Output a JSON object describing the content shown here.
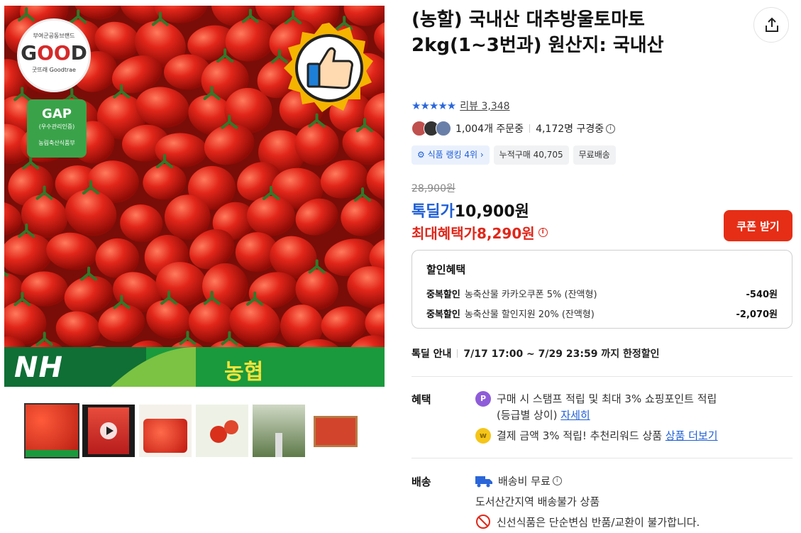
{
  "gallery": {
    "badge_good_top": "부여군공동브랜드",
    "badge_good_word": "GOOD",
    "badge_good_bottom": "굿뜨래 Goodtrae",
    "badge_gap_title": "GAP",
    "badge_gap_sub": "(우수관리인증)",
    "badge_gap_org": "농림축산식품부",
    "bar_logo": "NH",
    "bar_name": "농협",
    "thumbnail_count": 6
  },
  "product": {
    "title": "(농할) 국내산 대추방울토마토 2kg(1~3번과) 원산지: 국내산"
  },
  "rating": {
    "stars": "★★★★★",
    "review_text": "리뷰 3,348"
  },
  "orders": {
    "ordering": "1,004개 주문중",
    "viewing": "4,172명 구경중"
  },
  "chips": {
    "ranking": "식품 랭킹 4위",
    "cumulative": "누적구매 40,705",
    "free_ship": "무료배송"
  },
  "price": {
    "original": "28,900원",
    "deal_label": "톡딜가",
    "deal_price": "10,900원",
    "max_label": "최대혜택가",
    "max_price": "8,290원",
    "coupon_button": "쿠폰 받기"
  },
  "discounts": {
    "title": "할인혜택",
    "rows": [
      {
        "kind": "중복할인",
        "desc": "농축산물 카카오쿠폰 5% (잔액형)",
        "amount": "-540원"
      },
      {
        "kind": "중복할인",
        "desc": "농축산물 할인지원 20% (잔액형)",
        "amount": "-2,070원"
      }
    ]
  },
  "notice": {
    "label": "톡딜 안내",
    "text": "7/17 17:00 ~ 7/29 23:59 까지 한정할인"
  },
  "benefits": {
    "label": "혜택",
    "line1": "구매 시 스탬프 적립 및 최대 3% 쇼핑포인트 적립",
    "line1b": "(등급별 상이)",
    "detail_link": "자세히",
    "line2": "결제 금액 3% 적립! 추천리워드 상품",
    "more_link": "상품 더보기",
    "icon1_letter": "P"
  },
  "shipping": {
    "label": "배송",
    "fee": "배송비 무료",
    "restriction": "도서산간지역 배송불가 상품",
    "policy": "신선식품은 단순변심 반품/교환이 불가합니다."
  },
  "colors": {
    "accent_blue": "#1f5fd6",
    "accent_red": "#e0271a",
    "coupon_red": "#e62e16"
  }
}
